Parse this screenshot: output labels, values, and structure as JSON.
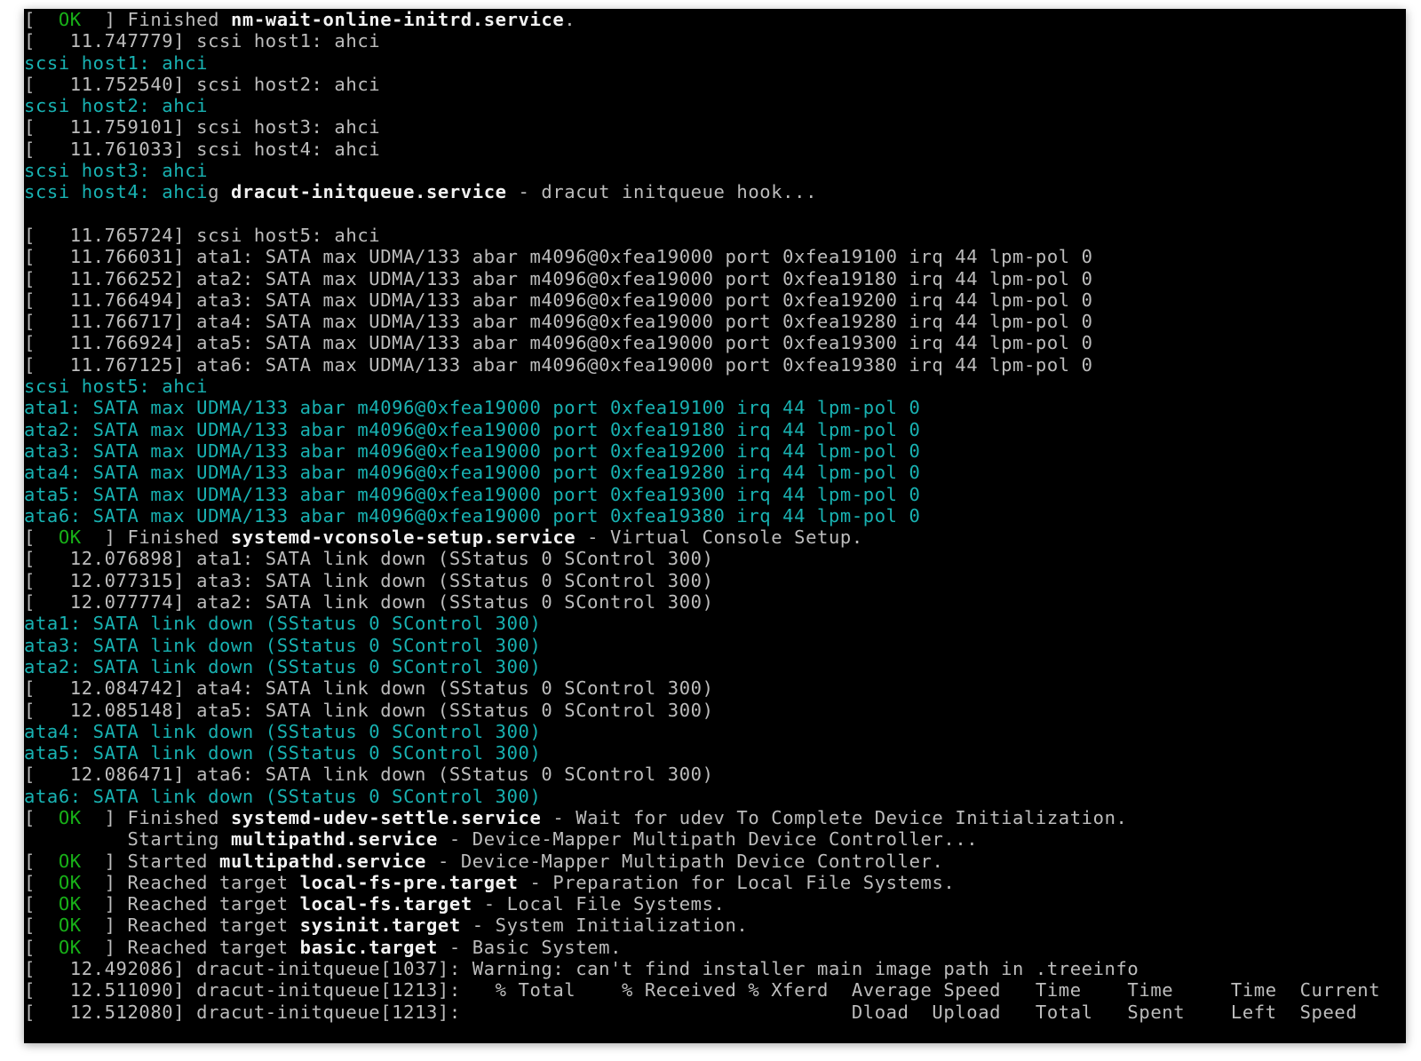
{
  "lines": [
    [
      {
        "t": "[  ",
        "c": "gray"
      },
      {
        "t": "OK",
        "c": "green"
      },
      {
        "t": "  ] Finished ",
        "c": "gray"
      },
      {
        "t": "nm-wait-online-initrd.service",
        "c": "white"
      },
      {
        "t": ".",
        "c": "gray"
      }
    ],
    [
      {
        "t": "[   11.747779] scsi host1: ahci",
        "c": "gray"
      }
    ],
    [
      {
        "t": "scsi host1: ahci",
        "c": "cyan"
      }
    ],
    [
      {
        "t": "[   11.752540] scsi host2: ahci",
        "c": "gray"
      }
    ],
    [
      {
        "t": "scsi host2: ahci",
        "c": "cyan"
      }
    ],
    [
      {
        "t": "[   11.759101] scsi host3: ahci",
        "c": "gray"
      }
    ],
    [
      {
        "t": "[   11.761033] scsi host4: ahci",
        "c": "gray"
      }
    ],
    [
      {
        "t": "scsi host3: ahci",
        "c": "cyan"
      }
    ],
    [
      {
        "t": "scsi host4: ahci",
        "c": "cyan"
      },
      {
        "t": "g ",
        "c": "gray"
      },
      {
        "t": "dracut-initqueue.service",
        "c": "white"
      },
      {
        "t": " - dracut initqueue hook...",
        "c": "gray"
      }
    ],
    [
      {
        "t": "",
        "c": "gray"
      }
    ],
    [
      {
        "t": "[   11.765724] scsi host5: ahci",
        "c": "gray"
      }
    ],
    [
      {
        "t": "[   11.766031] ata1: SATA max UDMA/133 abar m4096@0xfea19000 port 0xfea19100 irq 44 lpm-pol 0",
        "c": "gray"
      }
    ],
    [
      {
        "t": "[   11.766252] ata2: SATA max UDMA/133 abar m4096@0xfea19000 port 0xfea19180 irq 44 lpm-pol 0",
        "c": "gray"
      }
    ],
    [
      {
        "t": "[   11.766494] ata3: SATA max UDMA/133 abar m4096@0xfea19000 port 0xfea19200 irq 44 lpm-pol 0",
        "c": "gray"
      }
    ],
    [
      {
        "t": "[   11.766717] ata4: SATA max UDMA/133 abar m4096@0xfea19000 port 0xfea19280 irq 44 lpm-pol 0",
        "c": "gray"
      }
    ],
    [
      {
        "t": "[   11.766924] ata5: SATA max UDMA/133 abar m4096@0xfea19000 port 0xfea19300 irq 44 lpm-pol 0",
        "c": "gray"
      }
    ],
    [
      {
        "t": "[   11.767125] ata6: SATA max UDMA/133 abar m4096@0xfea19000 port 0xfea19380 irq 44 lpm-pol 0",
        "c": "gray"
      }
    ],
    [
      {
        "t": "scsi host5: ahci",
        "c": "cyan"
      }
    ],
    [
      {
        "t": "ata1: SATA max UDMA/133 abar m4096@0xfea19000 port 0xfea19100 irq 44 lpm-pol 0",
        "c": "cyan"
      }
    ],
    [
      {
        "t": "ata2: SATA max UDMA/133 abar m4096@0xfea19000 port 0xfea19180 irq 44 lpm-pol 0",
        "c": "cyan"
      }
    ],
    [
      {
        "t": "ata3: SATA max UDMA/133 abar m4096@0xfea19000 port 0xfea19200 irq 44 lpm-pol 0",
        "c": "cyan"
      }
    ],
    [
      {
        "t": "ata4: SATA max UDMA/133 abar m4096@0xfea19000 port 0xfea19280 irq 44 lpm-pol 0",
        "c": "cyan"
      }
    ],
    [
      {
        "t": "ata5: SATA max UDMA/133 abar m4096@0xfea19000 port 0xfea19300 irq 44 lpm-pol 0",
        "c": "cyan"
      }
    ],
    [
      {
        "t": "ata6: SATA max UDMA/133 abar m4096@0xfea19000 port 0xfea19380 irq 44 lpm-pol 0",
        "c": "cyan"
      }
    ],
    [
      {
        "t": "[  ",
        "c": "gray"
      },
      {
        "t": "OK",
        "c": "green"
      },
      {
        "t": "  ] Finished ",
        "c": "gray"
      },
      {
        "t": "systemd-vconsole-setup.service",
        "c": "white"
      },
      {
        "t": " - Virtual Console Setup.",
        "c": "gray"
      }
    ],
    [
      {
        "t": "[   12.076898] ata1: SATA link down (SStatus 0 SControl 300)",
        "c": "gray"
      }
    ],
    [
      {
        "t": "[   12.077315] ata3: SATA link down (SStatus 0 SControl 300)",
        "c": "gray"
      }
    ],
    [
      {
        "t": "[   12.077774] ata2: SATA link down (SStatus 0 SControl 300)",
        "c": "gray"
      }
    ],
    [
      {
        "t": "ata1: SATA link down (SStatus 0 SControl 300)",
        "c": "cyan"
      }
    ],
    [
      {
        "t": "ata3: SATA link down (SStatus 0 SControl 300)",
        "c": "cyan"
      }
    ],
    [
      {
        "t": "ata2: SATA link down (SStatus 0 SControl 300)",
        "c": "cyan"
      }
    ],
    [
      {
        "t": "[   12.084742] ata4: SATA link down (SStatus 0 SControl 300)",
        "c": "gray"
      }
    ],
    [
      {
        "t": "[   12.085148] ata5: SATA link down (SStatus 0 SControl 300)",
        "c": "gray"
      }
    ],
    [
      {
        "t": "ata4: SATA link down (SStatus 0 SControl 300)",
        "c": "cyan"
      }
    ],
    [
      {
        "t": "ata5: SATA link down (SStatus 0 SControl 300)",
        "c": "cyan"
      }
    ],
    [
      {
        "t": "[   12.086471] ata6: SATA link down (SStatus 0 SControl 300)",
        "c": "gray"
      }
    ],
    [
      {
        "t": "ata6: SATA link down (SStatus 0 SControl 300)",
        "c": "cyan"
      }
    ],
    [
      {
        "t": "[  ",
        "c": "gray"
      },
      {
        "t": "OK",
        "c": "green"
      },
      {
        "t": "  ] Finished ",
        "c": "gray"
      },
      {
        "t": "systemd-udev-settle.service",
        "c": "white"
      },
      {
        "t": " - Wait for udev To Complete Device Initialization.",
        "c": "gray"
      }
    ],
    [
      {
        "t": "         Starting ",
        "c": "gray"
      },
      {
        "t": "multipathd.service",
        "c": "white"
      },
      {
        "t": " - Device-Mapper Multipath Device Controller...",
        "c": "gray"
      }
    ],
    [
      {
        "t": "[  ",
        "c": "gray"
      },
      {
        "t": "OK",
        "c": "green"
      },
      {
        "t": "  ] Started ",
        "c": "gray"
      },
      {
        "t": "multipathd.service",
        "c": "white"
      },
      {
        "t": " - Device-Mapper Multipath Device Controller.",
        "c": "gray"
      }
    ],
    [
      {
        "t": "[  ",
        "c": "gray"
      },
      {
        "t": "OK",
        "c": "green"
      },
      {
        "t": "  ] Reached target ",
        "c": "gray"
      },
      {
        "t": "local-fs-pre.target",
        "c": "white"
      },
      {
        "t": " - Preparation for Local File Systems.",
        "c": "gray"
      }
    ],
    [
      {
        "t": "[  ",
        "c": "gray"
      },
      {
        "t": "OK",
        "c": "green"
      },
      {
        "t": "  ] Reached target ",
        "c": "gray"
      },
      {
        "t": "local-fs.target",
        "c": "white"
      },
      {
        "t": " - Local File Systems.",
        "c": "gray"
      }
    ],
    [
      {
        "t": "[  ",
        "c": "gray"
      },
      {
        "t": "OK",
        "c": "green"
      },
      {
        "t": "  ] Reached target ",
        "c": "gray"
      },
      {
        "t": "sysinit.target",
        "c": "white"
      },
      {
        "t": " - System Initialization.",
        "c": "gray"
      }
    ],
    [
      {
        "t": "[  ",
        "c": "gray"
      },
      {
        "t": "OK",
        "c": "green"
      },
      {
        "t": "  ] Reached target ",
        "c": "gray"
      },
      {
        "t": "basic.target",
        "c": "white"
      },
      {
        "t": " - Basic System.",
        "c": "gray"
      }
    ],
    [
      {
        "t": "[   12.492086] dracut-initqueue[1037]: Warning: can't find installer main image path in .treeinfo",
        "c": "gray"
      }
    ],
    [
      {
        "t": "[   12.511090] dracut-initqueue[1213]:   % Total    % Received % Xferd  Average Speed   Time    Time     Time  Current",
        "c": "gray"
      }
    ],
    [
      {
        "t": "[   12.512080] dracut-initqueue[1213]:                                  Dload  Upload   Total   Spent    Left  Speed",
        "c": "gray"
      }
    ]
  ]
}
